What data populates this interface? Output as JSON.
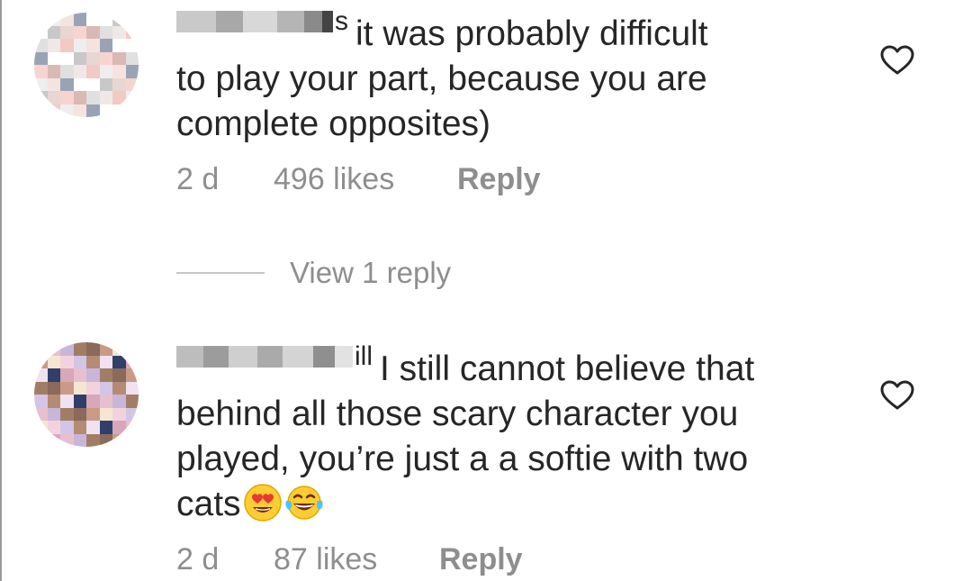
{
  "comments": [
    {
      "username_visible_tail": "s",
      "text": "it was probably difficult to play your part, because you are complete opposites)",
      "lines": [
        "it was probably difficult",
        "to play your part, because you are",
        "complete opposites)"
      ],
      "age": "2 d",
      "likes": "496 likes",
      "reply_label": "Reply",
      "view_replies": "View 1 reply"
    },
    {
      "username_visible_tail": "ill",
      "lines": [
        "I still cannot believe that",
        "behind all those scary character you",
        "played, you’re just a a softie with two",
        "cats"
      ],
      "emoji": [
        "heart-eyes-emoji",
        "tears-of-joy-emoji"
      ],
      "age": "2 d",
      "likes": "87 likes",
      "reply_label": "Reply"
    }
  ],
  "icons": {
    "like": "heart-outline-icon"
  },
  "colors": {
    "text": "#262626",
    "secondary": "#8e8e8e",
    "divider": "#c7c7c7"
  }
}
